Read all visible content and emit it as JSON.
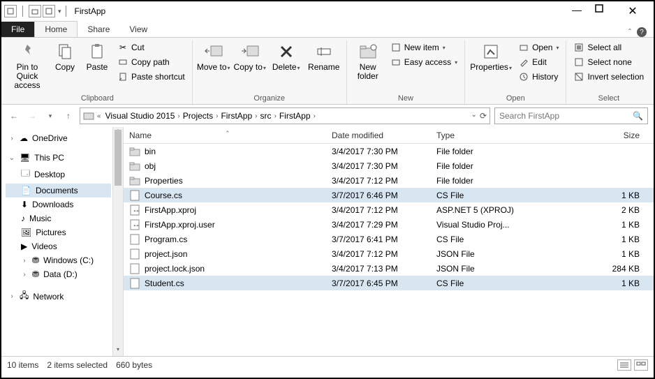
{
  "window": {
    "title": "FirstApp"
  },
  "tabs": {
    "file": "File",
    "home": "Home",
    "share": "Share",
    "view": "View"
  },
  "ribbon": {
    "clipboard": {
      "label": "Clipboard",
      "pin": "Pin to Quick access",
      "copy": "Copy",
      "paste": "Paste",
      "cut": "Cut",
      "copy_path": "Copy path",
      "paste_shortcut": "Paste shortcut"
    },
    "organize": {
      "label": "Organize",
      "move_to": "Move to",
      "copy_to": "Copy to",
      "delete": "Delete",
      "rename": "Rename"
    },
    "new": {
      "label": "New",
      "new_folder": "New folder",
      "new_item": "New item",
      "easy_access": "Easy access"
    },
    "open": {
      "label": "Open",
      "properties": "Properties",
      "open": "Open",
      "edit": "Edit",
      "history": "History"
    },
    "select": {
      "label": "Select",
      "select_all": "Select all",
      "select_none": "Select none",
      "invert": "Invert selection"
    }
  },
  "breadcrumbs": [
    "Visual Studio 2015",
    "Projects",
    "FirstApp",
    "src",
    "FirstApp"
  ],
  "search": {
    "placeholder": "Search FirstApp"
  },
  "sidebar": {
    "onedrive": "OneDrive",
    "thispc": "This PC",
    "desktop": "Desktop",
    "documents": "Documents",
    "downloads": "Downloads",
    "music": "Music",
    "pictures": "Pictures",
    "videos": "Videos",
    "cdrive": "Windows (C:)",
    "ddrive": "Data (D:)",
    "network": "Network"
  },
  "columns": {
    "name": "Name",
    "date": "Date modified",
    "type": "Type",
    "size": "Size"
  },
  "files": [
    {
      "name": "bin",
      "date": "3/4/2017 7:30 PM",
      "type": "File folder",
      "size": "",
      "icon": "folder",
      "selected": false
    },
    {
      "name": "obj",
      "date": "3/4/2017 7:30 PM",
      "type": "File folder",
      "size": "",
      "icon": "folder",
      "selected": false
    },
    {
      "name": "Properties",
      "date": "3/4/2017 7:12 PM",
      "type": "File folder",
      "size": "",
      "icon": "folder",
      "selected": false
    },
    {
      "name": "Course.cs",
      "date": "3/7/2017 6:46 PM",
      "type": "CS File",
      "size": "1 KB",
      "icon": "cs",
      "selected": true
    },
    {
      "name": "FirstApp.xproj",
      "date": "3/4/2017 7:12 PM",
      "type": "ASP.NET 5 (XPROJ)",
      "size": "2 KB",
      "icon": "proj",
      "selected": false
    },
    {
      "name": "FirstApp.xproj.user",
      "date": "3/4/2017 7:29 PM",
      "type": "Visual Studio Proj...",
      "size": "1 KB",
      "icon": "proj",
      "selected": false
    },
    {
      "name": "Program.cs",
      "date": "3/7/2017 6:41 PM",
      "type": "CS File",
      "size": "1 KB",
      "icon": "cs",
      "selected": false
    },
    {
      "name": "project.json",
      "date": "3/4/2017 7:12 PM",
      "type": "JSON File",
      "size": "1 KB",
      "icon": "file",
      "selected": false
    },
    {
      "name": "project.lock.json",
      "date": "3/4/2017 7:13 PM",
      "type": "JSON File",
      "size": "284 KB",
      "icon": "file",
      "selected": false
    },
    {
      "name": "Student.cs",
      "date": "3/7/2017 6:45 PM",
      "type": "CS File",
      "size": "1 KB",
      "icon": "cs",
      "selected": true
    }
  ],
  "status": {
    "items": "10 items",
    "selected": "2 items selected",
    "bytes": "660 bytes"
  }
}
